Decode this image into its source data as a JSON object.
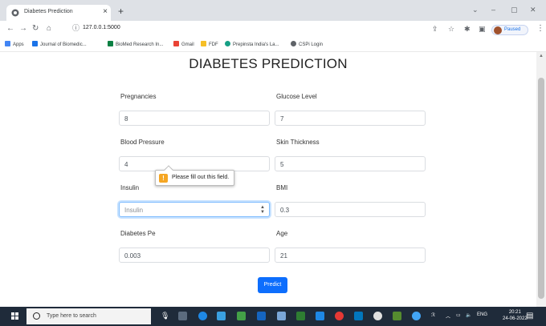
{
  "browser": {
    "tab_title": "Diabetes Prediction",
    "tab_close": "×",
    "new_tab": "+",
    "url": "127.0.0.1:5000",
    "profile_label": "Paused",
    "window_controls": {
      "chevron": "⌄",
      "minimize": "–",
      "maximize": "▢",
      "close": "✕"
    },
    "nav": {
      "back": "←",
      "forward": "→",
      "reload": "↻",
      "home": "⌂",
      "info": "ⓘ"
    }
  },
  "bookmarks": [
    {
      "label": "Apps",
      "color": "#4285f4"
    },
    {
      "label": "Journal of Biomedic...",
      "color": "#1a73e8"
    },
    {
      "label": "BioMed Research In...",
      "color": "#0b8043"
    },
    {
      "label": "Gmail",
      "color": "#ea4335"
    },
    {
      "label": "FDF",
      "color": "#f6bf26"
    },
    {
      "label": "Prepinsta India's La...",
      "color": "#16a085"
    },
    {
      "label": "CSPi Login",
      "color": "#5f6368"
    }
  ],
  "page": {
    "title": "DIABETES PREDICTION",
    "fields": [
      {
        "label": "Pregnancies",
        "value": "8"
      },
      {
        "label": "Glucose Level",
        "value": "7"
      },
      {
        "label": "Blood Pressure",
        "value": "4"
      },
      {
        "label": "Skin Thickness",
        "value": "5"
      },
      {
        "label": "Insulin",
        "value": "",
        "placeholder": "Insulin"
      },
      {
        "label": "BMI",
        "value": "0.3"
      },
      {
        "label": "Diabetes Pe",
        "value": "0.003"
      },
      {
        "label": "Age",
        "value": "21"
      }
    ],
    "validation_message": "Please fill out this field.",
    "warning_glyph": "!",
    "submit_label": "Predict"
  },
  "taskbar": {
    "search_placeholder": "Type here to search",
    "language": "ENG",
    "time": "20:21",
    "date": "24-06-2022"
  },
  "colors": {
    "primary": "#0d6efd",
    "focus_ring": "#80bdff",
    "taskbar_bg": "#1f2b3a",
    "warning": "#f5a623"
  }
}
